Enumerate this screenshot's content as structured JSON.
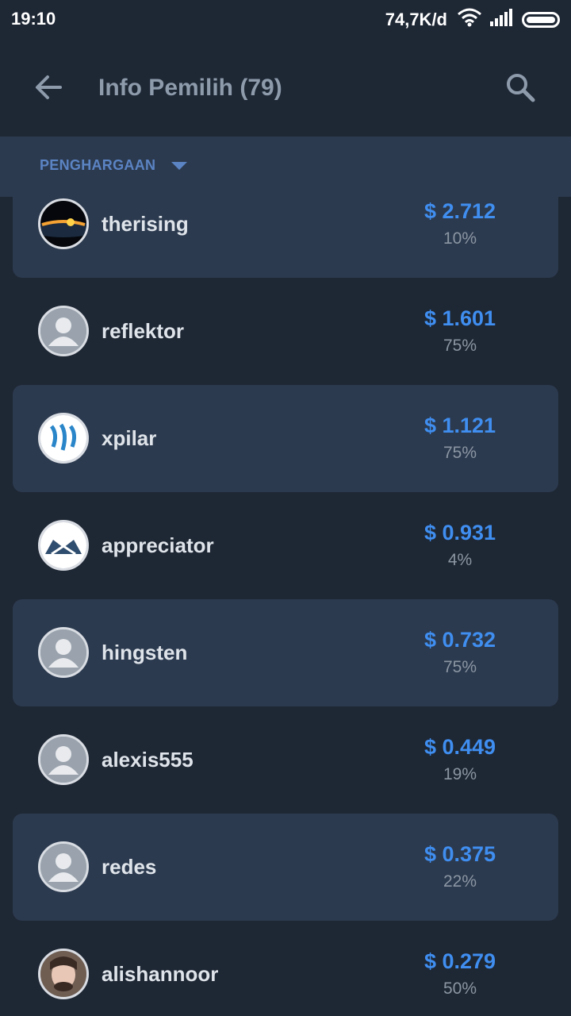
{
  "status_bar": {
    "time": "19:10",
    "net_speed": "74,7K/d",
    "icons": [
      "wifi-icon",
      "signal-icon",
      "battery-icon"
    ]
  },
  "app_bar": {
    "title": "Info Pemilih (79)",
    "back_icon": "arrow-left-icon",
    "search_icon": "search-icon"
  },
  "filter": {
    "label": "PENGHARGAAN"
  },
  "voters": [
    {
      "name": "therising",
      "amount": "$ 2.712",
      "percent": "10%",
      "avatar": "planet-eclipse",
      "shaded": true
    },
    {
      "name": "reflektor",
      "amount": "$ 1.601",
      "percent": "75%",
      "avatar": "default-user",
      "shaded": false
    },
    {
      "name": "xpilar",
      "amount": "$ 1.121",
      "percent": "75%",
      "avatar": "steem-logo",
      "shaded": true
    },
    {
      "name": "appreciator",
      "amount": "$ 0.931",
      "percent": "4%",
      "avatar": "crown-logo",
      "shaded": false
    },
    {
      "name": "hingsten",
      "amount": "$ 0.732",
      "percent": "75%",
      "avatar": "default-user",
      "shaded": true
    },
    {
      "name": "alexis555",
      "amount": "$ 0.449",
      "percent": "19%",
      "avatar": "default-user",
      "shaded": false
    },
    {
      "name": "redes",
      "amount": "$ 0.375",
      "percent": "22%",
      "avatar": "default-user",
      "shaded": true
    },
    {
      "name": "alishannoor",
      "amount": "$ 0.279",
      "percent": "50%",
      "avatar": "photo",
      "shaded": false
    }
  ],
  "colors": {
    "background": "#1e2734",
    "card": "#2c3a4f",
    "accent": "#3f8ef0",
    "filter_text": "#5b84c4"
  }
}
